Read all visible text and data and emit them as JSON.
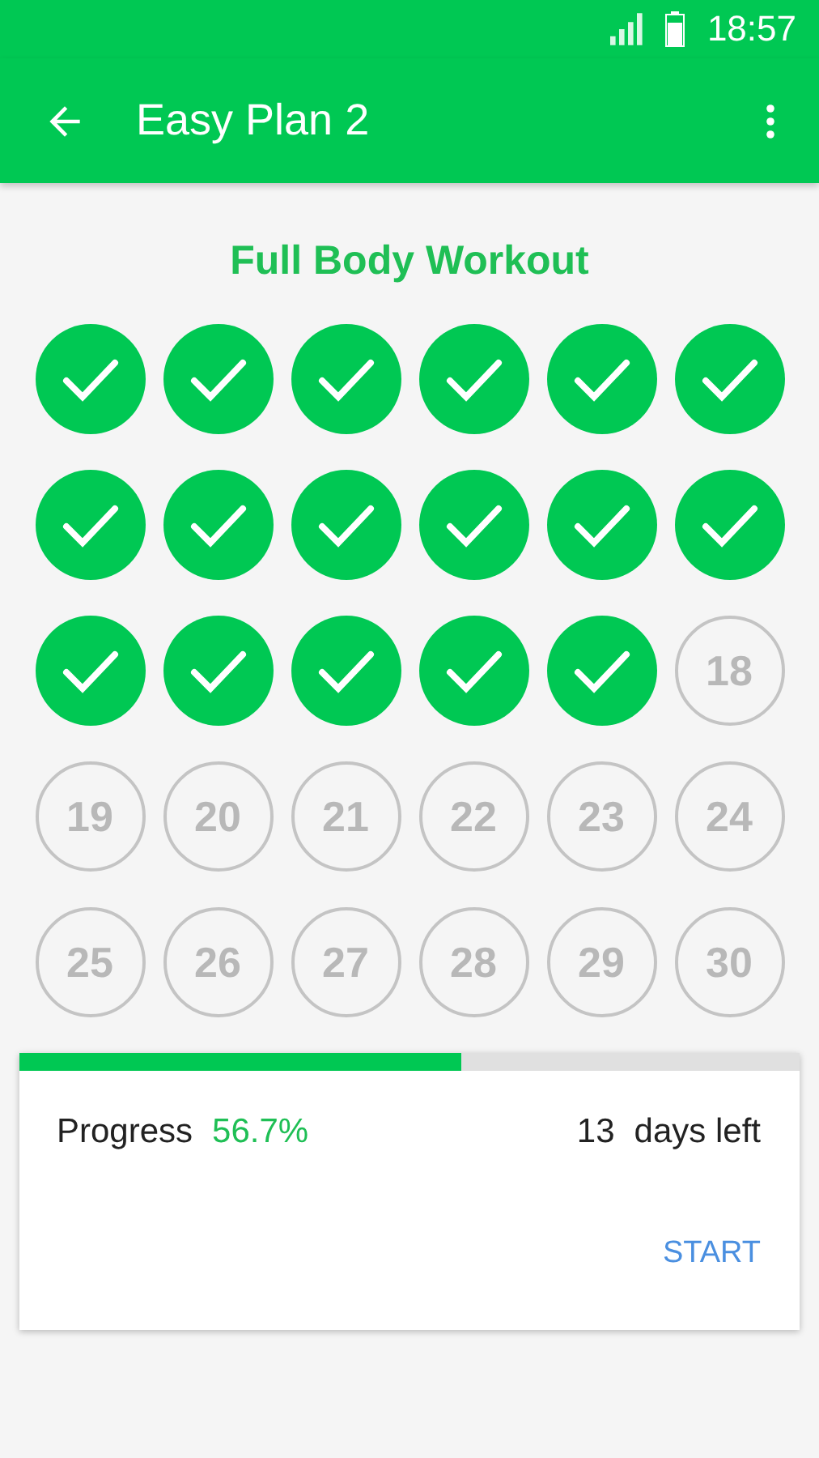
{
  "status_bar": {
    "time": "18:57"
  },
  "app_bar": {
    "title": "Easy Plan 2"
  },
  "workout_title": "Full Body Workout",
  "days": [
    {
      "done": true
    },
    {
      "done": true
    },
    {
      "done": true
    },
    {
      "done": true
    },
    {
      "done": true
    },
    {
      "done": true
    },
    {
      "done": true
    },
    {
      "done": true
    },
    {
      "done": true
    },
    {
      "done": true
    },
    {
      "done": true
    },
    {
      "done": true
    },
    {
      "done": true
    },
    {
      "done": true
    },
    {
      "done": true
    },
    {
      "done": true
    },
    {
      "done": true
    },
    {
      "done": false,
      "label": "18"
    },
    {
      "done": false,
      "label": "19"
    },
    {
      "done": false,
      "label": "20"
    },
    {
      "done": false,
      "label": "21"
    },
    {
      "done": false,
      "label": "22"
    },
    {
      "done": false,
      "label": "23"
    },
    {
      "done": false,
      "label": "24"
    },
    {
      "done": false,
      "label": "25"
    },
    {
      "done": false,
      "label": "26"
    },
    {
      "done": false,
      "label": "27"
    },
    {
      "done": false,
      "label": "28"
    },
    {
      "done": false,
      "label": "29"
    },
    {
      "done": false,
      "label": "30"
    }
  ],
  "progress": {
    "level": 0.567,
    "label": "Progress",
    "value": "56.7%",
    "days_count": "13",
    "days_label": "days left",
    "action": "START"
  }
}
